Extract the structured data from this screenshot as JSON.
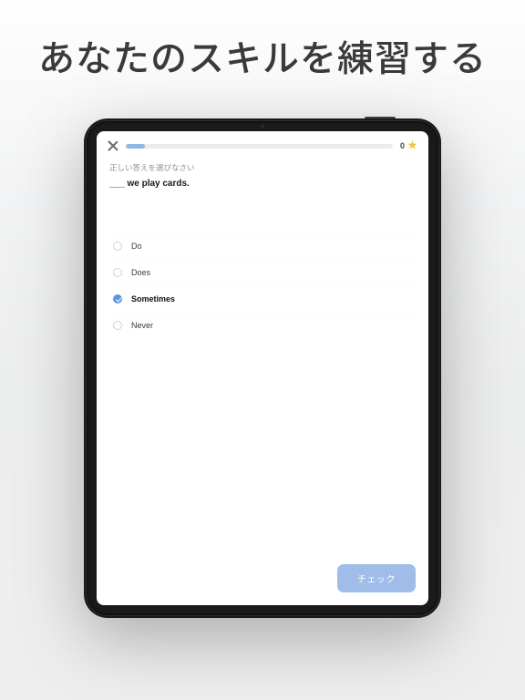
{
  "page": {
    "heading": "あなたのスキルを練習する"
  },
  "quiz": {
    "progress_pct": 7,
    "score": 0,
    "instruction": "正しい答えを選びなさい",
    "question": "___ we play cards.",
    "options": [
      {
        "label": "Do",
        "selected": false
      },
      {
        "label": "Does",
        "selected": false
      },
      {
        "label": "Sometimes",
        "selected": true
      },
      {
        "label": "Never",
        "selected": false
      }
    ],
    "check_label": "チェック"
  },
  "colors": {
    "accent": "#5e94dc",
    "accent_light": "#9fbde8",
    "star": "#f5c542"
  }
}
